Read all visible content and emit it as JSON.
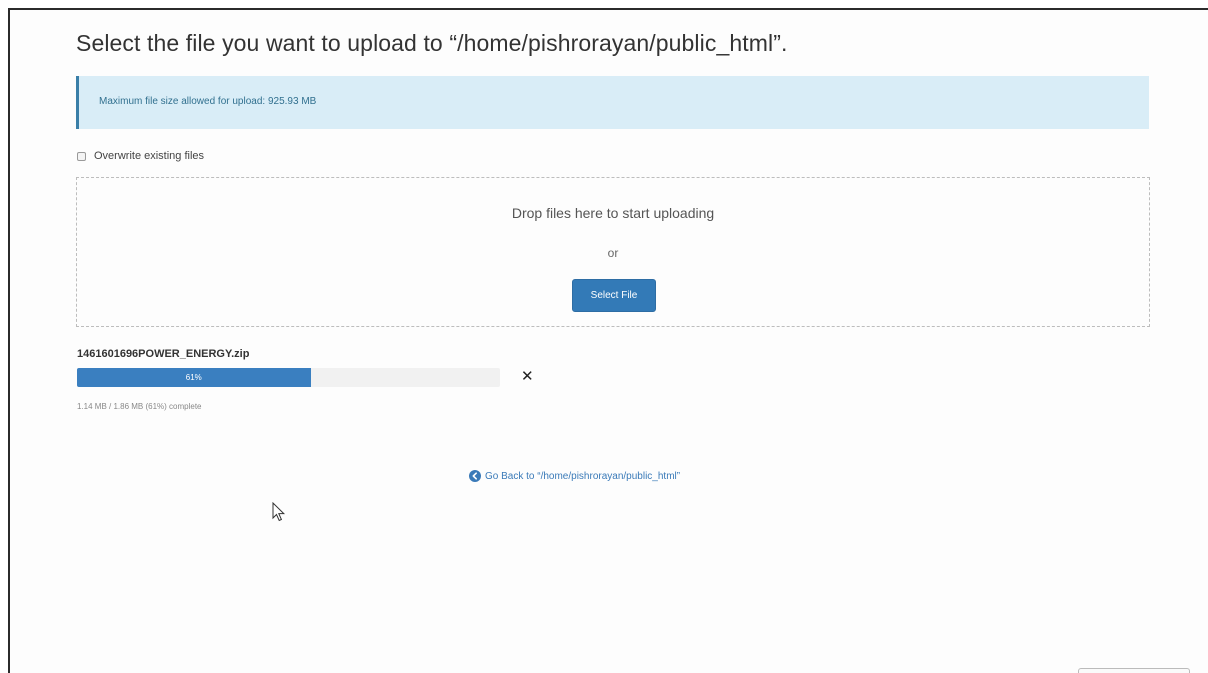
{
  "page": {
    "title": "Select the file you want to upload to “/home/pishrorayan/public_html”."
  },
  "alert": {
    "text": "Maximum file size allowed for upload: 925.93 MB"
  },
  "overwrite": {
    "label": "Overwrite existing files",
    "checked": false
  },
  "dropzone": {
    "drop_text": "Drop files here to start uploading",
    "or_text": "or",
    "select_button": "Select File"
  },
  "upload": {
    "filename": "1461601696POWER_ENERGY.zip",
    "progress_label": "61%",
    "progress_percent": 61,
    "status": "1.14 MB / 1.86 MB (61%) complete",
    "cancel_icon": "close-icon"
  },
  "nav": {
    "go_back": "Go Back to “/home/pishrorayan/public_html”",
    "go_back_icon": "circle-arrow-left-icon"
  },
  "colors": {
    "accent": "#337ab7",
    "alert_bg": "#d9edf7",
    "alert_border": "#3a7fa8"
  }
}
